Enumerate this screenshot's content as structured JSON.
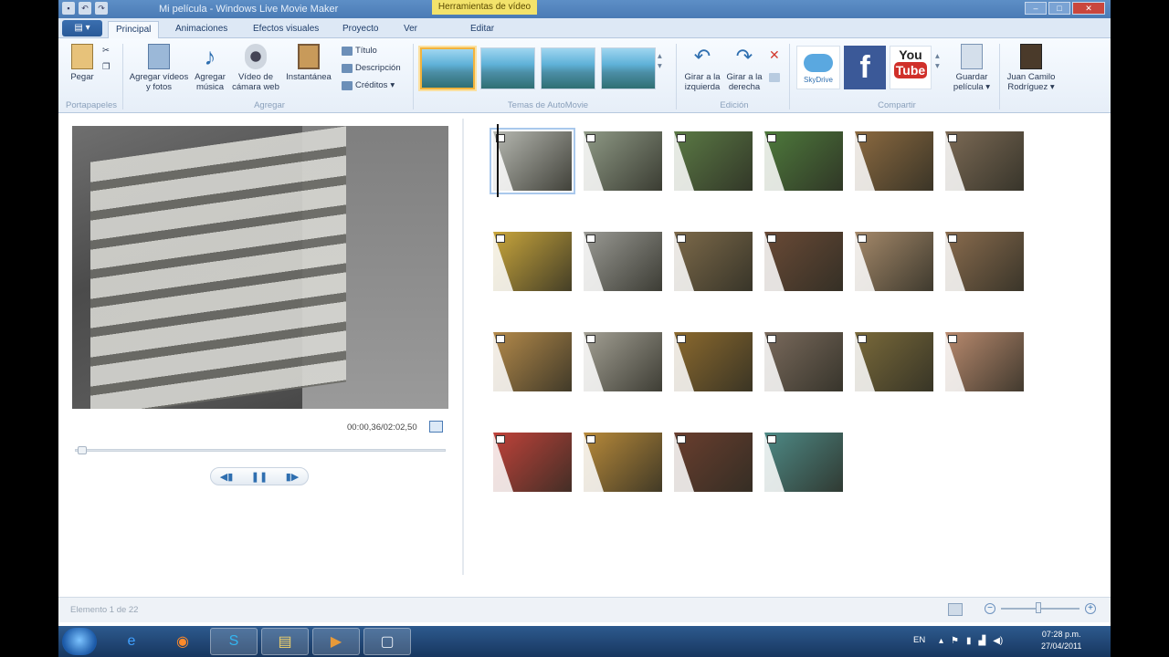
{
  "window": {
    "title": "Mi película - Windows Live Movie Maker",
    "contextual_tab_group": "Herramientas de vídeo",
    "controls": [
      "–",
      "□",
      "✕"
    ]
  },
  "tabs": [
    {
      "label": "Principal",
      "active": true
    },
    {
      "label": "Animaciones"
    },
    {
      "label": "Efectos visuales"
    },
    {
      "label": "Proyecto"
    },
    {
      "label": "Ver"
    },
    {
      "label": "Editar"
    }
  ],
  "ribbon": {
    "portapapeles": {
      "label": "Portapapeles",
      "paste": "Pegar"
    },
    "agregar": {
      "label": "Agregar",
      "add_videos": "Agregar vídeos y fotos",
      "add_music": "Agregar música",
      "webcam": "Vídeo de cámara web",
      "snapshot": "Instantánea",
      "title": "Título",
      "caption": "Descripción",
      "credits": "Créditos"
    },
    "temas": {
      "label": "Temas de AutoMovie"
    },
    "edicion": {
      "label": "Edición",
      "rotate_left": "Girar a la izquierda",
      "rotate_right": "Girar a la derecha"
    },
    "compartir": {
      "label": "Compartir",
      "skydrive": "SkyDrive",
      "youtube_top": "You",
      "youtube_bottom": "Tube",
      "facebook": "f",
      "save_movie": "Guardar película",
      "user": "Juan Camilo Rodríguez"
    }
  },
  "preview": {
    "timecode": "00:00,36/02:02,50",
    "progress": 0.005
  },
  "storyboard": {
    "items": [
      {
        "color": "#b7b9b2",
        "selected": true
      },
      {
        "color": "#8f9a86"
      },
      {
        "color": "#5b7a45"
      },
      {
        "color": "#4e7a3c"
      },
      {
        "color": "#8c6a40"
      },
      {
        "color": "#7c6a55"
      },
      {
        "color": "#c9a63c"
      },
      {
        "color": "#9a9a94"
      },
      {
        "color": "#7d6a4a"
      },
      {
        "color": "#6a4a36"
      },
      {
        "color": "#a5896a"
      },
      {
        "color": "#8a6c4e"
      },
      {
        "color": "#b48a4a"
      },
      {
        "color": "#a3a094"
      },
      {
        "color": "#8c6a2e"
      },
      {
        "color": "#7a6a5c"
      },
      {
        "color": "#7a6a3a"
      },
      {
        "color": "#b98a6e"
      },
      {
        "color": "#c0423a"
      },
      {
        "color": "#b88a3a"
      },
      {
        "color": "#6a3e2e"
      },
      {
        "color": "#4e8a86"
      }
    ]
  },
  "status": {
    "text": "Elemento 1 de 22"
  },
  "taskbar": {
    "items": [
      {
        "icon": "ie-icon",
        "glyph": "e"
      },
      {
        "icon": "firefox-icon",
        "glyph": "◉"
      },
      {
        "icon": "skype-icon",
        "glyph": "S"
      },
      {
        "icon": "explorer-icon",
        "glyph": "▤"
      },
      {
        "icon": "moviemaker-icon",
        "glyph": "▶"
      },
      {
        "icon": "window-icon",
        "glyph": "▢"
      }
    ],
    "lang": "EN",
    "time": "07:28 p.m.",
    "date": "27/04/2011"
  }
}
